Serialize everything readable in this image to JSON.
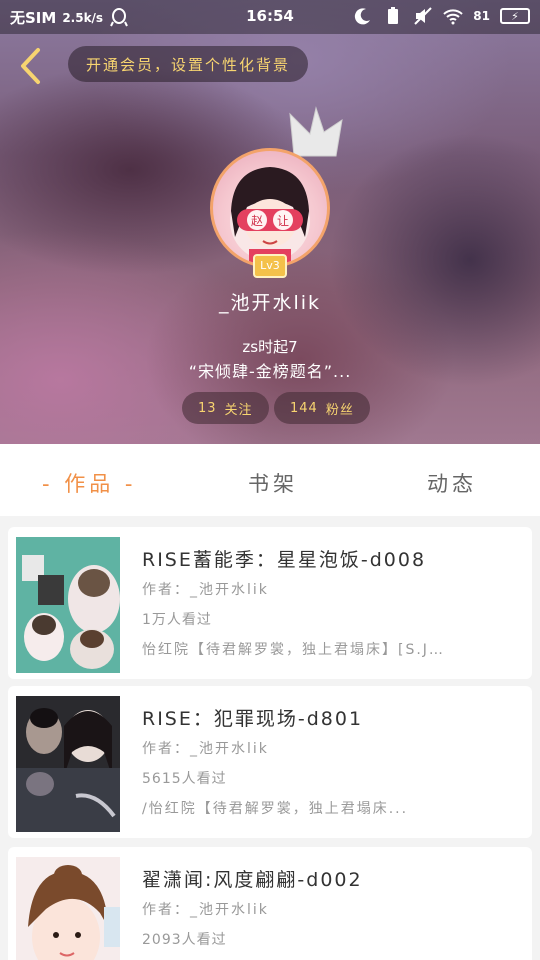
{
  "status_bar": {
    "carrier": "无SIM",
    "speed": "2.5k/s",
    "time": "16:54",
    "battery": "81"
  },
  "header": {
    "vip_prompt": "开通会员，设置个性化背景",
    "avatar_text": "赵 让",
    "level": "Lv3",
    "username": "_池开水lik",
    "bio_line1": "zs时起7",
    "bio_line2": "“宋倾肆-金榜题名”...",
    "follow_count": "13",
    "follow_label": "关注",
    "fans_count": "144",
    "fans_label": "粉丝"
  },
  "tabs": {
    "works": "- 作品 -",
    "shelf": "书架",
    "moments": "动态"
  },
  "books": [
    {
      "title": "RISE蓄能季：星星泡饭-d008",
      "author": "作者：_池开水lik",
      "views": "1万人看过",
      "desc": "怡红院【待君解罗裳，独上君塌床】[S.J…"
    },
    {
      "title": "RISE：犯罪现场-d801",
      "author": "作者：_池开水lik",
      "views": "5615人看过",
      "desc": "/怡红院【待君解罗裳，独上君塌床..."
    },
    {
      "title": "翟潇闻:风度翩翩-d002",
      "author": "作者：_池开水lik",
      "views": "2093人看过",
      "desc": ""
    }
  ],
  "colors": {
    "accent": "#f19047",
    "gold": "#f7d470"
  }
}
